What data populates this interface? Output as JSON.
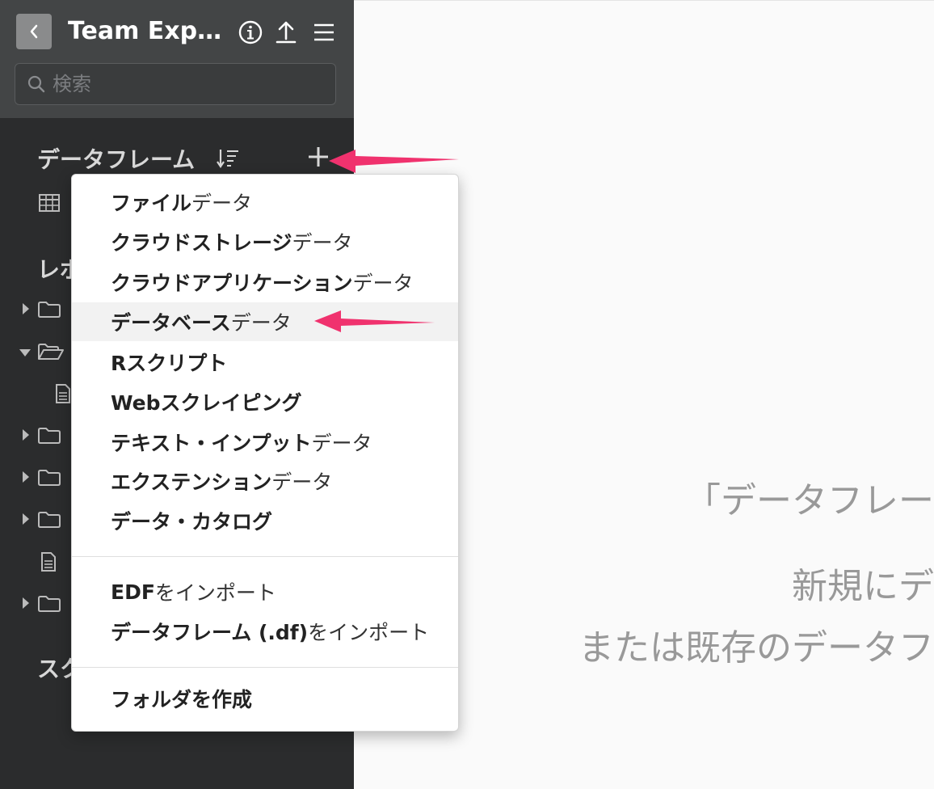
{
  "header": {
    "title": "Team Expl…",
    "search_placeholder": "検索"
  },
  "sidebar": {
    "dataframes_title": "データフレーム",
    "reports_title_partial": "レポ",
    "scripts_title_partial": "スク"
  },
  "main": {
    "line1": "「データフレー",
    "line2": "新規にデ",
    "line3": "または既存のデータフ"
  },
  "menu": {
    "items": [
      {
        "bold": "ファイル",
        "normal": "データ"
      },
      {
        "bold": "クラウドストレージ",
        "normal": "データ"
      },
      {
        "bold": "クラウドアプリケーション",
        "normal": "データ"
      },
      {
        "bold": "データベース",
        "normal": "データ"
      },
      {
        "bold": "Rスクリプト",
        "normal": ""
      },
      {
        "bold": "Webスクレイピング",
        "normal": ""
      },
      {
        "bold": "テキスト・インプット",
        "normal": "データ"
      },
      {
        "bold": "エクステンション",
        "normal": "データ"
      },
      {
        "bold": "データ・カタログ",
        "normal": ""
      }
    ],
    "import_items": [
      {
        "bold": "EDF",
        "normal": "をインポート"
      },
      {
        "bold": "データフレーム (.df)",
        "normal": "をインポート"
      }
    ],
    "folder_item": {
      "bold": "フォルダを作成",
      "normal": ""
    }
  },
  "colors": {
    "sidebar_bg": "#2b2c2d",
    "header_bg": "#434546",
    "annotation_arrow": "#f0326e"
  },
  "icons": {
    "back": "chevron-left-icon",
    "info": "info-icon",
    "upload": "upload-icon",
    "menu": "hamburger-icon",
    "sort": "sort-icon",
    "add": "plus-icon",
    "table": "table-icon",
    "folder": "folder-icon",
    "folder_open": "folder-open-icon",
    "document": "document-icon"
  }
}
